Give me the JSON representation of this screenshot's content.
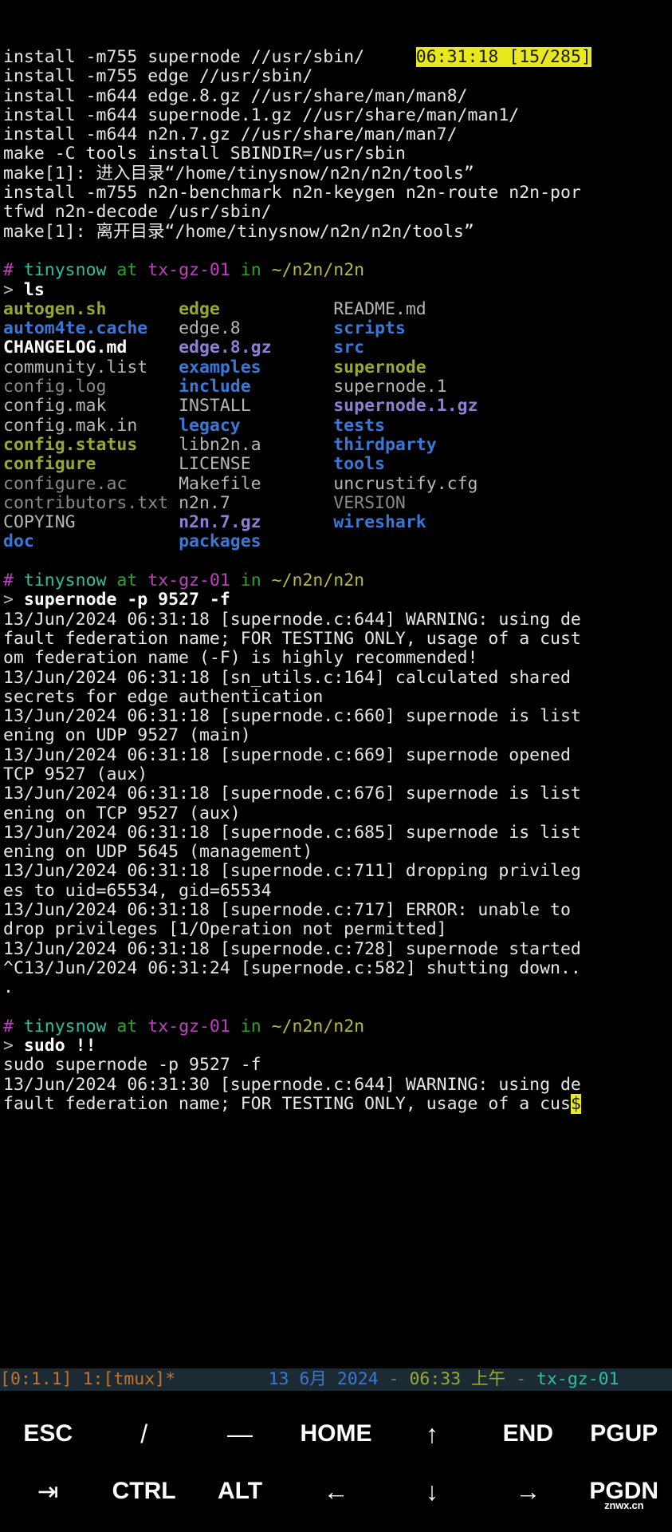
{
  "terminal": {
    "highlight": "06:31:18 [15/285]",
    "prompt": {
      "symbol": "#",
      "user": "tinysnow",
      "at": "at",
      "host": "tx-gz-01",
      "in": "in",
      "path": "~/n2n/n2n",
      "arrow": ">"
    },
    "build_output": [
      "install -m755 supernode //usr/sbin/",
      "install -m755 edge //usr/sbin/",
      "install -m644 edge.8.gz //usr/share/man/man8/",
      "install -m644 supernode.1.gz //usr/share/man/man1/",
      "install -m644 n2n.7.gz //usr/share/man/man7/",
      "make -C tools install SBINDIR=/usr/sbin",
      "make[1]: 进入目录“/home/tinysnow/n2n/n2n/tools”",
      "install -m755 n2n-benchmark n2n-keygen n2n-route n2n-por",
      "tfwd n2n-decode /usr/sbin/",
      "make[1]: 离开目录“/home/tinysnow/n2n/n2n/tools”"
    ],
    "commands": {
      "ls": "ls",
      "supernode": "supernode -p 9527 -f",
      "sudo_bang": "sudo !!",
      "sudo_expanded": "sudo supernode -p 9527 -f"
    },
    "ls_columns": [
      [
        {
          "name": "autogen.sh",
          "kind": "exec"
        },
        {
          "name": "autom4te.cache",
          "kind": "dir"
        },
        {
          "name": "CHANGELOG.md",
          "kind": "bold"
        },
        {
          "name": "community.list",
          "kind": "file"
        },
        {
          "name": "config.log",
          "kind": "dim"
        },
        {
          "name": "config.mak",
          "kind": "file"
        },
        {
          "name": "config.mak.in",
          "kind": "file"
        },
        {
          "name": "config.status",
          "kind": "exec"
        },
        {
          "name": "configure",
          "kind": "exec"
        },
        {
          "name": "configure.ac",
          "kind": "dim"
        },
        {
          "name": "contributors.txt",
          "kind": "dim"
        },
        {
          "name": "COPYING",
          "kind": "file"
        },
        {
          "name": "doc",
          "kind": "dir"
        }
      ],
      [
        {
          "name": "edge",
          "kind": "exec"
        },
        {
          "name": "edge.8",
          "kind": "file"
        },
        {
          "name": "edge.8.gz",
          "kind": "archive"
        },
        {
          "name": "examples",
          "kind": "dir"
        },
        {
          "name": "include",
          "kind": "dir"
        },
        {
          "name": "INSTALL",
          "kind": "file"
        },
        {
          "name": "legacy",
          "kind": "dir"
        },
        {
          "name": "libn2n.a",
          "kind": "file"
        },
        {
          "name": "LICENSE",
          "kind": "file"
        },
        {
          "name": "Makefile",
          "kind": "file"
        },
        {
          "name": "n2n.7",
          "kind": "file"
        },
        {
          "name": "n2n.7.gz",
          "kind": "archive"
        },
        {
          "name": "packages",
          "kind": "dir"
        }
      ],
      [
        {
          "name": "README.md",
          "kind": "file"
        },
        {
          "name": "scripts",
          "kind": "dir"
        },
        {
          "name": "src",
          "kind": "dir"
        },
        {
          "name": "supernode",
          "kind": "exec"
        },
        {
          "name": "supernode.1",
          "kind": "file"
        },
        {
          "name": "supernode.1.gz",
          "kind": "archive"
        },
        {
          "name": "tests",
          "kind": "dir"
        },
        {
          "name": "thirdparty",
          "kind": "dir"
        },
        {
          "name": "tools",
          "kind": "dir"
        },
        {
          "name": "uncrustify.cfg",
          "kind": "file"
        },
        {
          "name": "VERSION",
          "kind": "dim"
        },
        {
          "name": "wireshark",
          "kind": "dir"
        }
      ]
    ],
    "supernode_log": [
      "13/Jun/2024 06:31:18 [supernode.c:644] WARNING: using de",
      "fault federation name; FOR TESTING ONLY, usage of a cust",
      "om federation name (-F) is highly recommended!",
      "13/Jun/2024 06:31:18 [sn_utils.c:164] calculated shared",
      "secrets for edge authentication",
      "13/Jun/2024 06:31:18 [supernode.c:660] supernode is list",
      "ening on UDP 9527 (main)",
      "13/Jun/2024 06:31:18 [supernode.c:669] supernode opened",
      "TCP 9527 (aux)",
      "13/Jun/2024 06:31:18 [supernode.c:676] supernode is list",
      "ening on TCP 9527 (aux)",
      "13/Jun/2024 06:31:18 [supernode.c:685] supernode is list",
      "ening on UDP 5645 (management)",
      "13/Jun/2024 06:31:18 [supernode.c:711] dropping privileg",
      "es to uid=65534, gid=65534",
      "13/Jun/2024 06:31:18 [supernode.c:717] ERROR: unable to",
      "drop privileges [1/Operation not permitted]",
      "13/Jun/2024 06:31:18 [supernode.c:728] supernode started",
      "^C13/Jun/2024 06:31:24 [supernode.c:582] shutting down..",
      "."
    ],
    "sudo_log": [
      "13/Jun/2024 06:31:30 [supernode.c:644] WARNING: using de",
      "fault federation name; FOR TESTING ONLY, usage of a cus"
    ],
    "cursor": "$"
  },
  "tmux_status": {
    "session": "[0:1.1]",
    "window": "1:[tmux]*",
    "date_day": "13",
    "date_month": "6月",
    "date_year": "2024",
    "separator": "-",
    "time": "06:33",
    "ampm": "上午",
    "host": "tx-gz-01"
  },
  "keybar": {
    "row1": [
      {
        "label": "ESC",
        "name": "key-esc"
      },
      {
        "label": "/",
        "name": "key-slash"
      },
      {
        "label": "—",
        "name": "key-dash"
      },
      {
        "label": "HOME",
        "name": "key-home"
      },
      {
        "label": "↑",
        "name": "key-up"
      },
      {
        "label": "END",
        "name": "key-end"
      },
      {
        "label": "PGUP",
        "name": "key-pgup"
      }
    ],
    "row2": [
      {
        "label": "⇥",
        "name": "key-tab"
      },
      {
        "label": "CTRL",
        "name": "key-ctrl"
      },
      {
        "label": "ALT",
        "name": "key-alt"
      },
      {
        "label": "←",
        "name": "key-left"
      },
      {
        "label": "↓",
        "name": "key-down"
      },
      {
        "label": "→",
        "name": "key-right"
      },
      {
        "label": "PGDN",
        "name": "key-pgdn"
      }
    ],
    "watermark": "znwx.cn"
  },
  "colors": {
    "background": "#000000",
    "foreground": "#d8d8d8",
    "highlight_bg": "#e8e81f",
    "dir_blue": "#3a78d8",
    "exec_olive": "#9aa832",
    "archive_violet": "#8f7fd4",
    "status_bg": "#1c2a33",
    "status_orange": "#c4742a"
  }
}
